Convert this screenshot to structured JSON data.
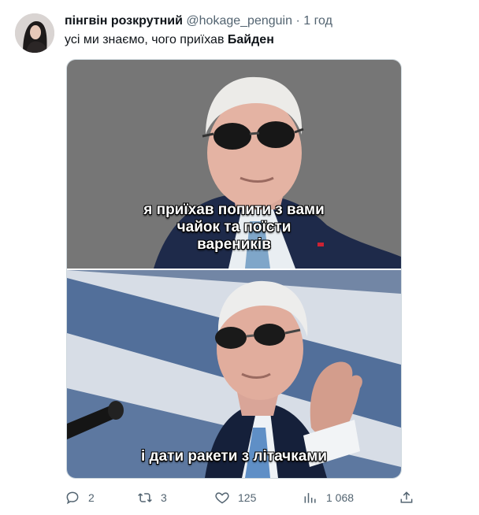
{
  "author": {
    "display_name": "пінгвін розкрутний",
    "handle": "@hokage_penguin",
    "separator": "·",
    "time": "1 год"
  },
  "tweet": {
    "text_plain": "усі ми знаємо, чого приїхав ",
    "text_bold": "Байден"
  },
  "media": {
    "top_caption_lines": [
      "я приїхав попити з вами",
      "чайок та поїсти",
      "вареників"
    ],
    "bottom_caption": "і дати ракети з літачками"
  },
  "actions": {
    "replies": "2",
    "retweets": "3",
    "likes": "125",
    "views": "1 068"
  },
  "colors": {
    "text_primary": "#0f1419",
    "text_secondary": "#536471",
    "border": "#cfd9de"
  }
}
